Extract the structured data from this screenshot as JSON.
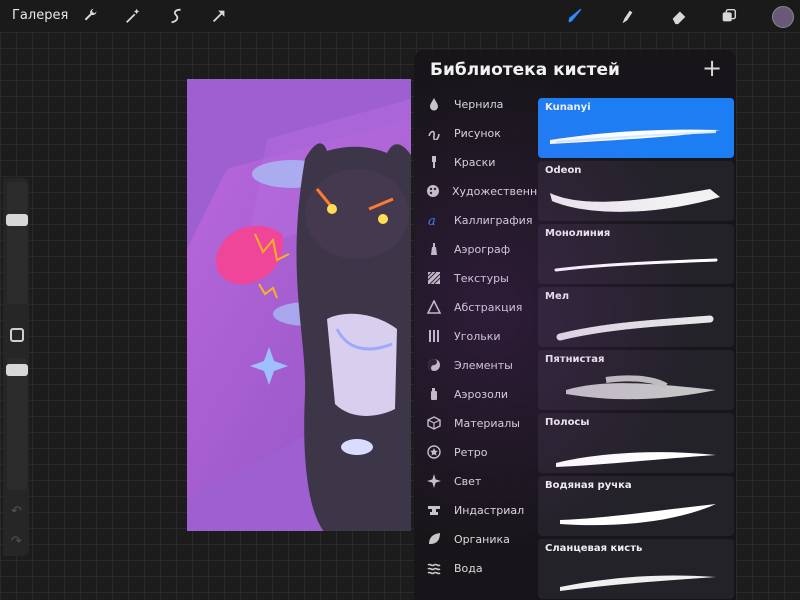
{
  "topbar": {
    "gallery_label": "Галерея",
    "tools_left": [
      {
        "icon": "wrench-icon"
      },
      {
        "icon": "magic-wand-icon"
      },
      {
        "icon": "selection-icon"
      },
      {
        "icon": "transform-arrow-icon"
      }
    ],
    "tools_right": [
      {
        "icon": "brush-icon",
        "active": true
      },
      {
        "icon": "smudge-icon"
      },
      {
        "icon": "eraser-icon"
      },
      {
        "icon": "layers-icon"
      }
    ],
    "current_color": "#6a5878"
  },
  "colors": {
    "accent": "#1d7ef4",
    "panel_bg": "#18161a",
    "canvas_bg": "#9e5fd0"
  },
  "sidebar": {
    "brush_size_level": 0.17,
    "opacity_level": 0.09
  },
  "brush_library": {
    "title": "Библиотека кистей",
    "add_icon": "plus-icon",
    "categories": [
      {
        "label": "Чернила",
        "icon": "ink-drop-icon"
      },
      {
        "label": "Рисунок",
        "icon": "squiggle-icon"
      },
      {
        "label": "Краски",
        "icon": "paint-brush-icon"
      },
      {
        "label": "Художественные",
        "icon": "palette-icon"
      },
      {
        "label": "Каллиграфия",
        "icon": "calligraphy-icon"
      },
      {
        "label": "Аэрограф",
        "icon": "airbrush-icon"
      },
      {
        "label": "Текстуры",
        "icon": "texture-icon"
      },
      {
        "label": "Абстракция",
        "icon": "triangle-icon"
      },
      {
        "label": "Угольки",
        "icon": "charcoal-icon"
      },
      {
        "label": "Элементы",
        "icon": "yin-yang-icon"
      },
      {
        "label": "Аэрозоли",
        "icon": "spray-can-icon"
      },
      {
        "label": "Материалы",
        "icon": "cube-icon"
      },
      {
        "label": "Ретро",
        "icon": "star-circle-icon"
      },
      {
        "label": "Свет",
        "icon": "sparkle-icon"
      },
      {
        "label": "Индастриал",
        "icon": "anvil-icon"
      },
      {
        "label": "Органика",
        "icon": "leaf-icon"
      },
      {
        "label": "Вода",
        "icon": "waves-icon"
      }
    ],
    "selected_category": "Каллиграфия",
    "brushes": [
      {
        "name": "Kunanyi",
        "selected": true
      },
      {
        "name": "Odeon",
        "selected": false
      },
      {
        "name": "Монолиния",
        "selected": false
      },
      {
        "name": "Мел",
        "selected": false
      },
      {
        "name": "Пятнистая",
        "selected": false
      },
      {
        "name": "Полосы",
        "selected": false
      },
      {
        "name": "Водяная ручка",
        "selected": false
      },
      {
        "name": "Сланцевая кисть",
        "selected": false
      }
    ]
  }
}
